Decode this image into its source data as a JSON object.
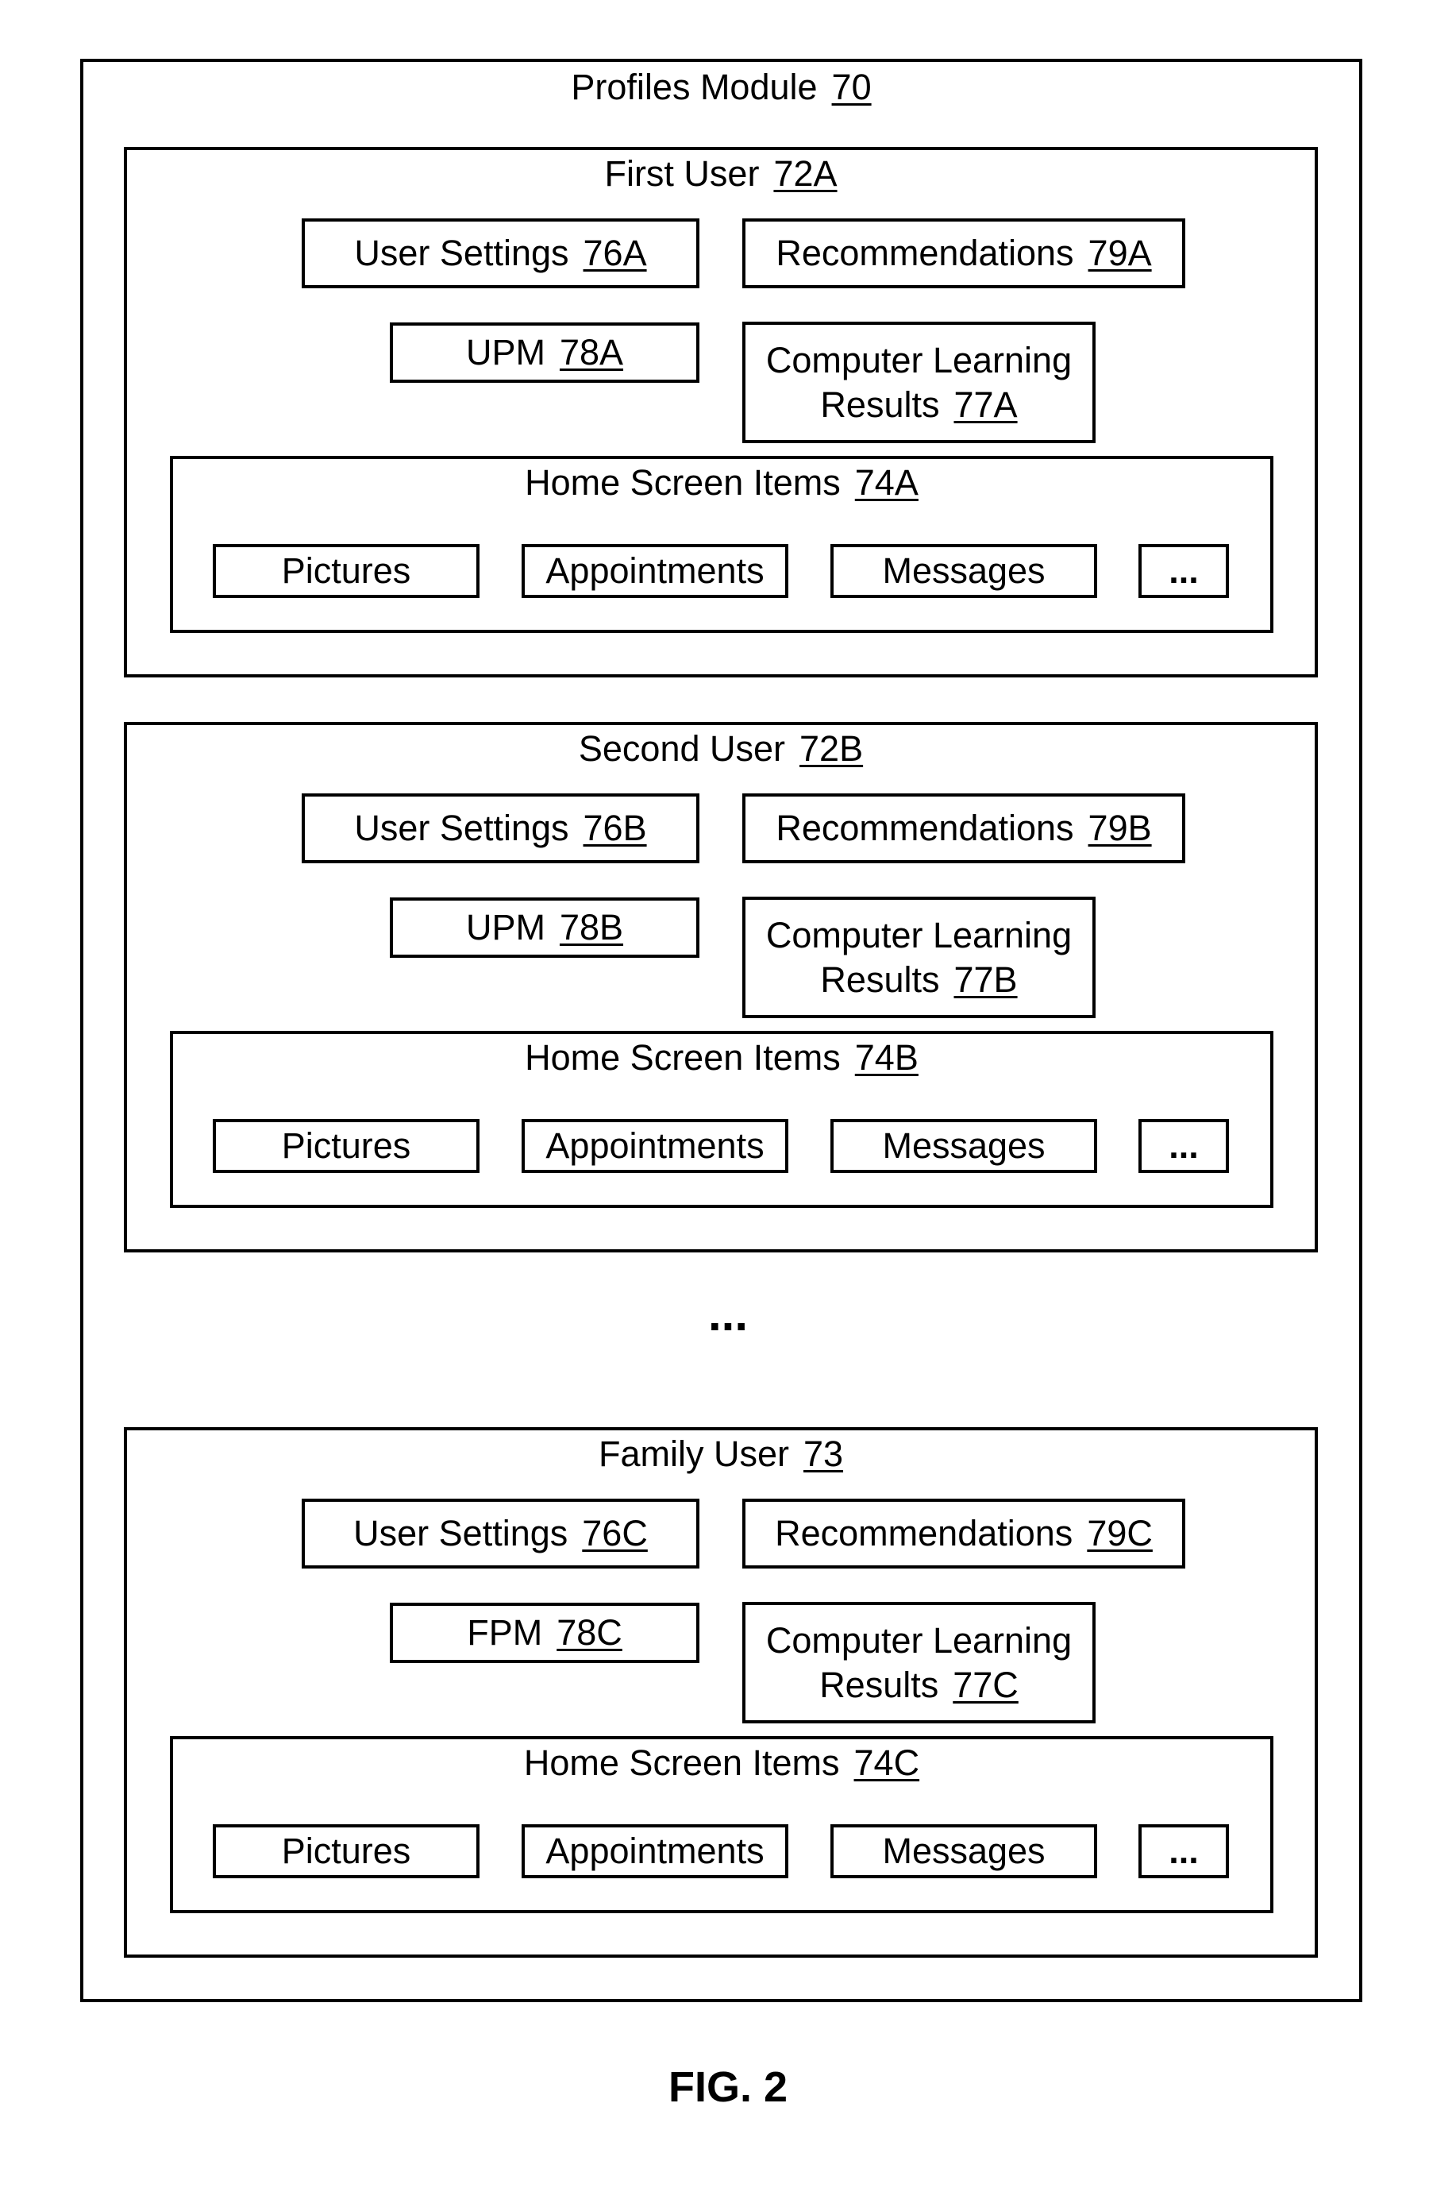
{
  "module": {
    "title": "Profiles Module",
    "ref": "70"
  },
  "sections": [
    {
      "title": "First User",
      "ref": "72A",
      "settings": {
        "label": "User Settings",
        "ref": "76A"
      },
      "recommendations": {
        "label": "Recommendations",
        "ref": "79A"
      },
      "profile_manager": {
        "label": "UPM",
        "ref": "78A"
      },
      "learning": {
        "label_line1": "Computer Learning",
        "label_line2": "Results",
        "ref": "77A"
      },
      "home_screen": {
        "title": "Home Screen Items",
        "ref": "74A",
        "items": [
          "Pictures",
          "Appointments",
          "Messages",
          "..."
        ]
      }
    },
    {
      "title": "Second User",
      "ref": "72B",
      "settings": {
        "label": "User Settings",
        "ref": "76B"
      },
      "recommendations": {
        "label": "Recommendations",
        "ref": "79B"
      },
      "profile_manager": {
        "label": "UPM",
        "ref": "78B"
      },
      "learning": {
        "label_line1": "Computer Learning",
        "label_line2": "Results",
        "ref": "77B"
      },
      "home_screen": {
        "title": "Home Screen Items",
        "ref": "74B",
        "items": [
          "Pictures",
          "Appointments",
          "Messages",
          "..."
        ]
      }
    },
    {
      "title": "Family User",
      "ref": "73",
      "settings": {
        "label": "User Settings",
        "ref": "76C"
      },
      "recommendations": {
        "label": "Recommendations",
        "ref": "79C"
      },
      "profile_manager": {
        "label": "FPM",
        "ref": "78C"
      },
      "learning": {
        "label_line1": "Computer Learning",
        "label_line2": "Results",
        "ref": "77C"
      },
      "home_screen": {
        "title": "Home Screen Items",
        "ref": "74C",
        "items": [
          "Pictures",
          "Appointments",
          "Messages",
          "..."
        ]
      }
    }
  ],
  "separator": "...",
  "figure_label": "FIG. 2"
}
